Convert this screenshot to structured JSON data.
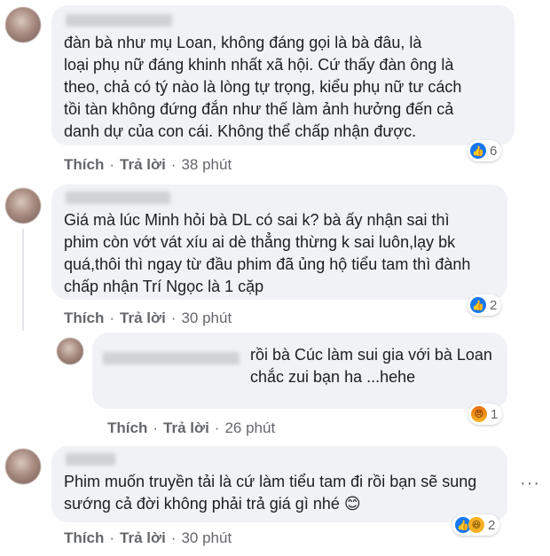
{
  "comments": [
    {
      "text": "        đàn bà như mụ Loan, không đáng gọi là bà đâu, là\nloại phụ nữ đáng khinh nhất xã hội. Cứ thấy đàn ông là\ntheo, chả có tý nào là lòng tự trọng, kiểu phụ nữ tư cách\ntồi tàn không đứng đắn như thế làm ảnh hưởng đến cả\ndanh dự của con cái. Không thể chấp nhận được.",
      "like_label": "Thích",
      "reply_label": "Trả lời",
      "time": "38 phút",
      "reaction_count": "6"
    },
    {
      "text": "Giá mà lúc Minh hỏi bà DL có sai k? bà ấy nhận sai thì\nphim còn vớt vát xíu ai dè thẳng thừng k sai luôn,lạy bk\nquá,thôi thì ngay từ đầu phim đã ủng hộ tiểu tam thì đành\nchấp nhận Trí Ngọc là 1 cặp",
      "like_label": "Thích",
      "reply_label": "Trả lời",
      "time": "30 phút",
      "reaction_count": "2"
    },
    {
      "text": "rồi bà Cúc làm sui gia với bà Loan\nchắc zui bạn ha ...hehe",
      "like_label": "Thích",
      "reply_label": "Trả lời",
      "time": "26 phút",
      "reaction_count": "1"
    },
    {
      "text": "Phim muốn truyền tải là cứ làm tiểu tam đi rồi bạn sẽ sung\nsướng cả đời không phải trả giá gì nhé 😊",
      "like_label": "Thích",
      "reply_label": "Trả lời",
      "time": "30 phút",
      "reaction_count": "2"
    }
  ],
  "icons": {
    "like": "like-icon",
    "haha": "haha-icon",
    "angry": "angry-icon",
    "more": "more-options-icon"
  },
  "more_glyph": "···"
}
